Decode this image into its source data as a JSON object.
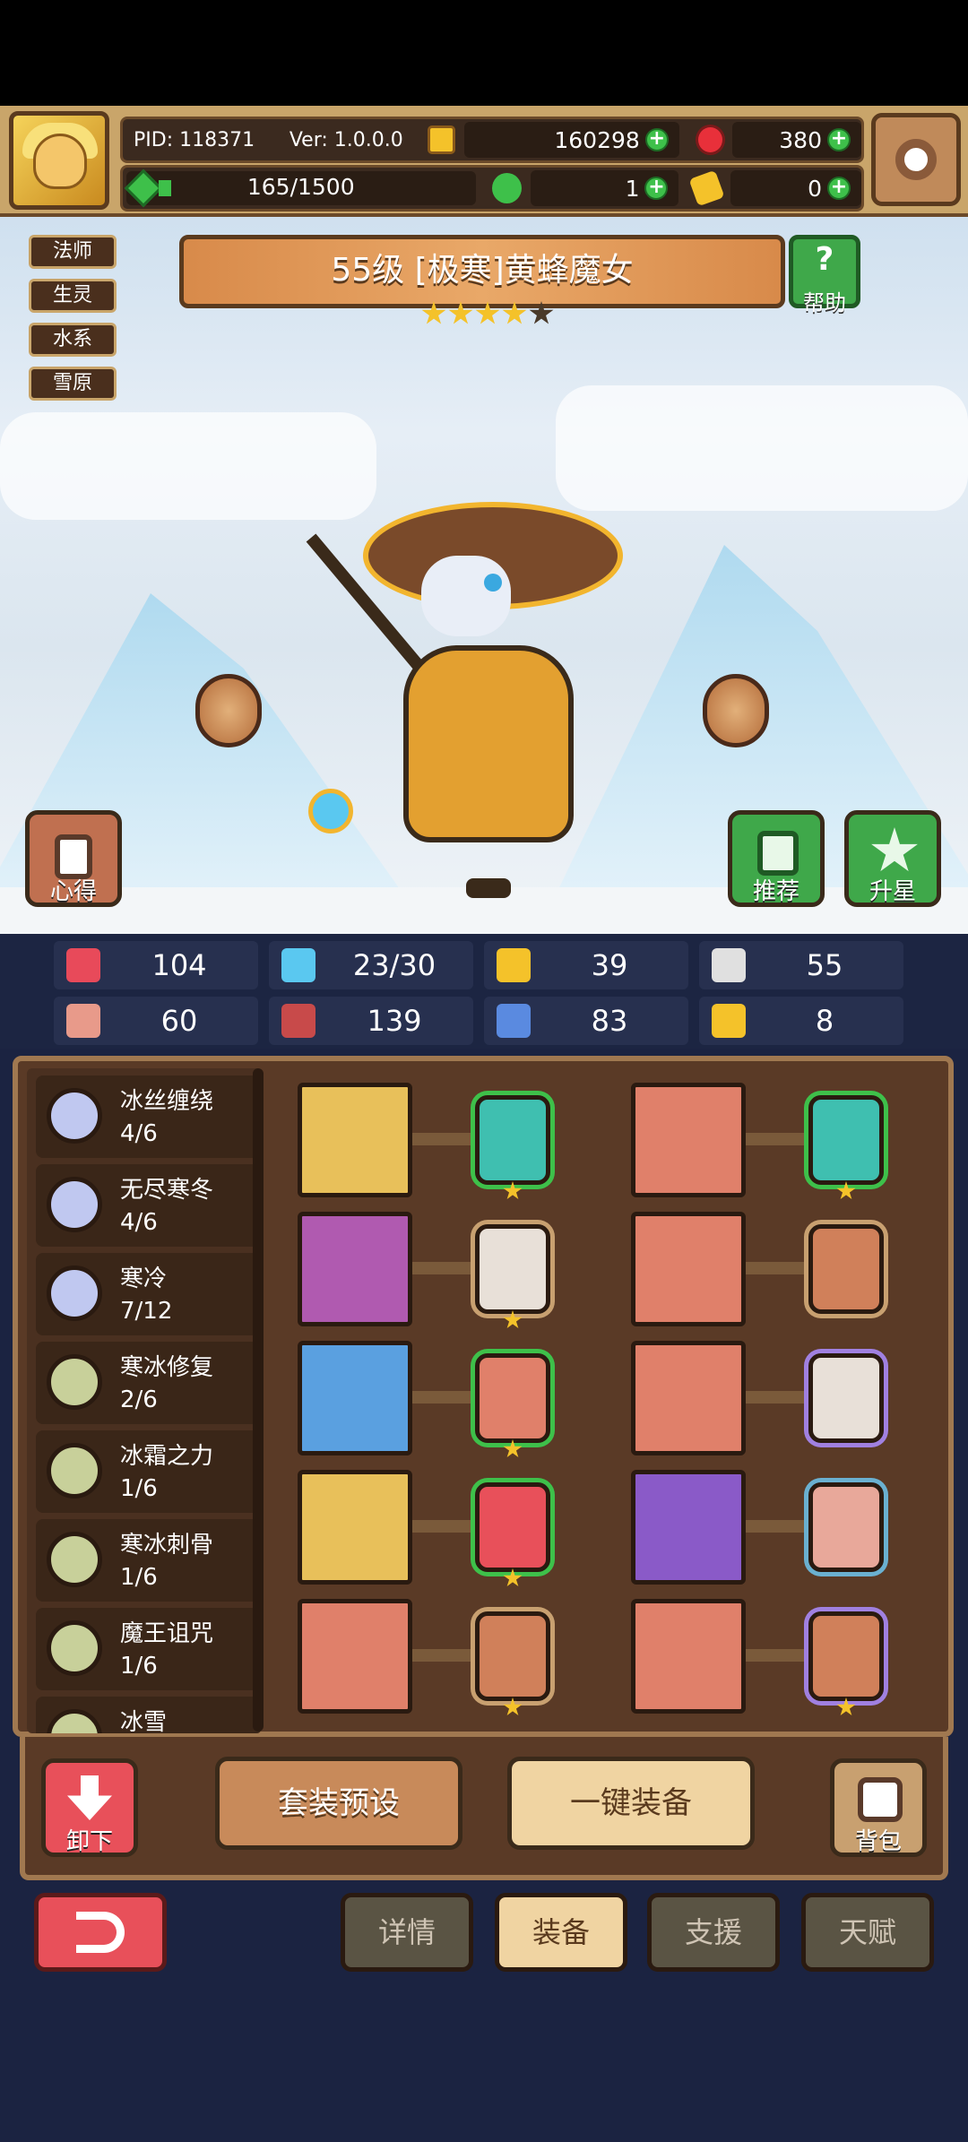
{
  "header": {
    "pid": "PID: 118371",
    "version": "Ver: 1.0.0.0",
    "gold": "160298",
    "gems": "380",
    "energy": "165/1500",
    "clover": "1",
    "keys": "0"
  },
  "tags": [
    "法师",
    "生灵",
    "水系",
    "雪原"
  ],
  "hero": {
    "title": "55级  [极寒]黄蜂魔女",
    "stars_filled": 4,
    "stars_total": 5
  },
  "buttons": {
    "help": "帮助",
    "notes": "心得",
    "recommend": "推荐",
    "star_up": "升星",
    "unequip": "卸下",
    "set_preset": "套装预设",
    "auto_equip": "一键装备",
    "bag": "背包"
  },
  "stats": [
    {
      "icon": "heart-icon",
      "value": "104",
      "color": "#e84a5a"
    },
    {
      "icon": "water-drop-icon",
      "value": "23/30",
      "color": "#5ac8f0"
    },
    {
      "icon": "shield-icon",
      "value": "39",
      "color": "#f4c22a"
    },
    {
      "icon": "wing-icon",
      "value": "55",
      "color": "#e0e0e0"
    },
    {
      "icon": "fist-icon",
      "value": "60",
      "color": "#e89a8a"
    },
    {
      "icon": "spellbook-icon",
      "value": "139",
      "color": "#c84a4a"
    },
    {
      "icon": "boot-icon",
      "value": "83",
      "color": "#5a8ae0"
    },
    {
      "icon": "horseshoe-icon",
      "value": "8",
      "color": "#f4c22a"
    }
  ],
  "skills": [
    {
      "name": "冰丝缠绕",
      "progress": "4/6",
      "color": "#c0c8f0"
    },
    {
      "name": "无尽寒冬",
      "progress": "4/6",
      "color": "#c0c8f0"
    },
    {
      "name": "寒冷",
      "progress": "7/12",
      "color": "#c0c8f0"
    },
    {
      "name": "寒冰修复",
      "progress": "2/6",
      "color": "#c8d09a"
    },
    {
      "name": "冰霜之力",
      "progress": "1/6",
      "color": "#c8d09a"
    },
    {
      "name": "寒冰刺骨",
      "progress": "1/6",
      "color": "#c8d09a"
    },
    {
      "name": "魔王诅咒",
      "progress": "1/6",
      "color": "#c8d09a"
    },
    {
      "name": "冰雪",
      "progress": "",
      "color": "#c8d09a"
    }
  ],
  "tabs": [
    {
      "label": "详情",
      "active": false
    },
    {
      "label": "装备",
      "active": true
    },
    {
      "label": "支援",
      "active": false
    },
    {
      "label": "天赋",
      "active": false
    }
  ]
}
